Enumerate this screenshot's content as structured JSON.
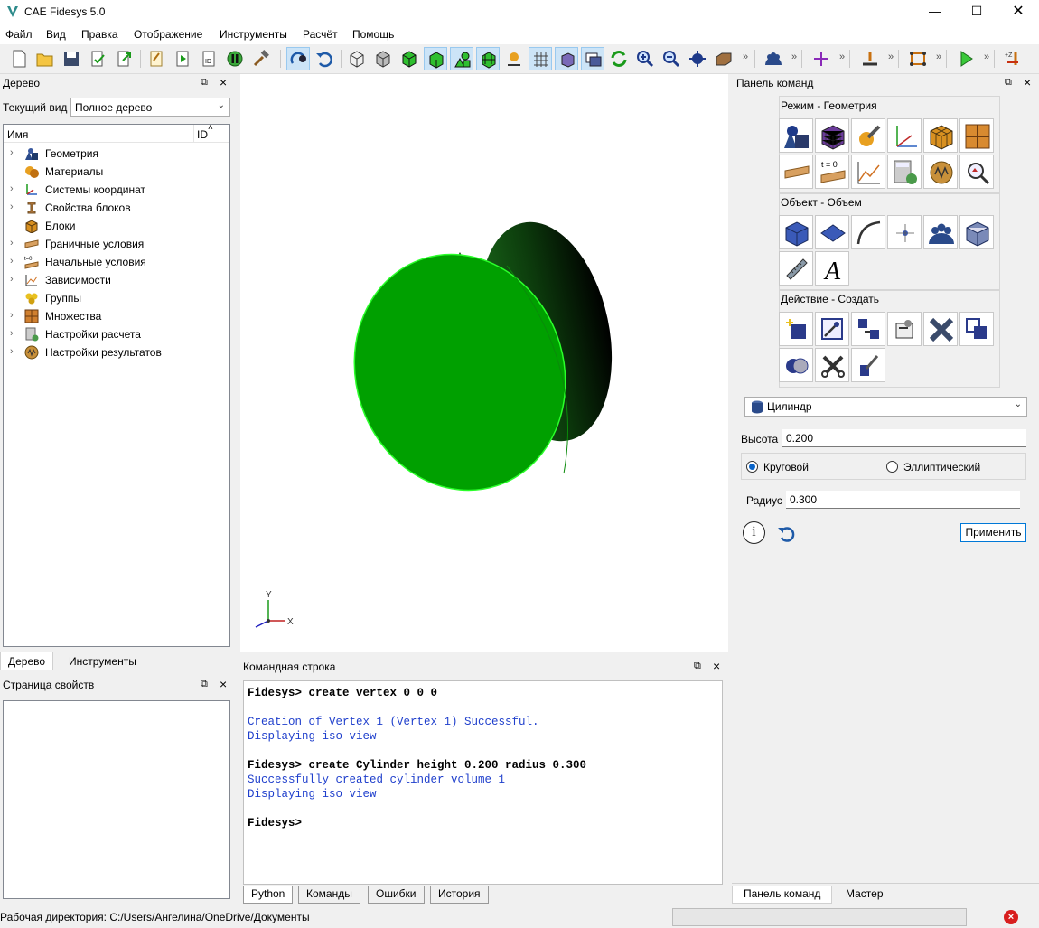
{
  "window": {
    "title": "CAE Fidesys 5.0"
  },
  "menu": [
    "Файл",
    "Вид",
    "Правка",
    "Отображение",
    "Инструменты",
    "Расчёт",
    "Помощь"
  ],
  "tree_panel": {
    "title": "Дерево",
    "view_label": "Текущий вид",
    "view_value": "Полное дерево",
    "col_name": "Имя",
    "col_id": "ID",
    "items": [
      {
        "label": "Геометрия",
        "icon": "geometry-icon",
        "expandable": true
      },
      {
        "label": "Материалы",
        "icon": "materials-icon",
        "expandable": false
      },
      {
        "label": "Системы координат",
        "icon": "coordinate-systems-icon",
        "expandable": true
      },
      {
        "label": "Свойства блоков",
        "icon": "block-properties-icon",
        "expandable": true
      },
      {
        "label": "Блоки",
        "icon": "blocks-icon",
        "expandable": false
      },
      {
        "label": "Граничные условия",
        "icon": "boundary-conditions-icon",
        "expandable": true
      },
      {
        "label": "Начальные условия",
        "icon": "initial-conditions-icon",
        "expandable": true
      },
      {
        "label": "Зависимости",
        "icon": "dependencies-icon",
        "expandable": true
      },
      {
        "label": "Группы",
        "icon": "groups-icon",
        "expandable": false
      },
      {
        "label": "Множества",
        "icon": "sets-icon",
        "expandable": true
      },
      {
        "label": "Настройки расчета",
        "icon": "calc-settings-icon",
        "expandable": true
      },
      {
        "label": "Настройки результатов",
        "icon": "result-settings-icon",
        "expandable": true
      }
    ],
    "tabs": [
      "Дерево",
      "Инструменты"
    ]
  },
  "props_panel": {
    "title": "Страница свойств"
  },
  "command_line": {
    "title": "Командная строка",
    "lines": [
      {
        "kind": "prompt",
        "text": "Fidesys> create vertex 0 0 0"
      },
      {
        "kind": "blank",
        "text": ""
      },
      {
        "kind": "blue",
        "text": "Creation of Vertex 1 (Vertex 1) Successful."
      },
      {
        "kind": "blue",
        "text": "Displaying iso view"
      },
      {
        "kind": "blank",
        "text": ""
      },
      {
        "kind": "prompt",
        "text": "Fidesys> create Cylinder height 0.200 radius 0.300"
      },
      {
        "kind": "blue",
        "text": "Successfully created cylinder volume 1"
      },
      {
        "kind": "blue",
        "text": "Displaying iso view"
      },
      {
        "kind": "blank",
        "text": ""
      },
      {
        "kind": "prompt",
        "text": "Fidesys>"
      }
    ],
    "tabs": [
      "Python",
      "Команды",
      "Ошибки",
      "История"
    ]
  },
  "command_panel": {
    "title": "Панель команд",
    "mode_title": "Режим - Геометрия",
    "object_title": "Объект - Объем",
    "action_title": "Действие - Создать",
    "shape_value": "Цилиндр",
    "height_label": "Высота",
    "height_value": "0.200",
    "radio_circular": "Круговой",
    "radio_elliptic": "Эллиптический",
    "radius_label": "Радиус",
    "radius_value": "0.300",
    "apply_label": "Применить",
    "tabs": [
      "Панель команд",
      "Мастер"
    ],
    "t0_label": "t = 0"
  },
  "viewport": {
    "axis_x": "X",
    "axis_y": "Y",
    "cylinder_color": "#00a000"
  },
  "status": {
    "workdir": "Рабочая директория: C:/Users/Ангелина/OneDrive/Документы"
  }
}
